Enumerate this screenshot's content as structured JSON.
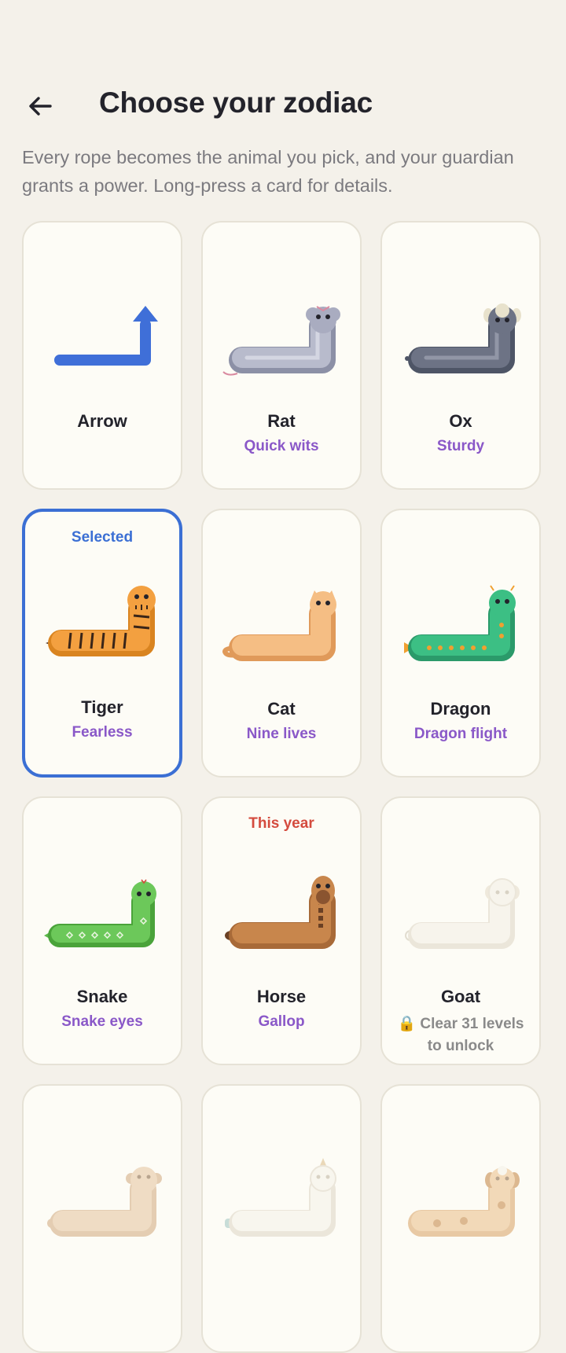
{
  "header": {
    "title": "Choose your zodiac",
    "subtitle": "Every rope becomes the animal you pick, and your guardian grants a power. Long-press a card for details.",
    "back_icon": "arrow-left-icon"
  },
  "colors": {
    "background": "#f4f1ea",
    "card": "#fdfcf6",
    "selected_border": "#3b6fd4",
    "power_text": "#8a58c8",
    "this_year_text": "#d44b3e"
  },
  "cards": [
    {
      "name": "Arrow",
      "power": "",
      "art": "arrow-icon"
    },
    {
      "name": "Rat",
      "power": "Quick wits",
      "art": "rat-rope-icon"
    },
    {
      "name": "Ox",
      "power": "Sturdy",
      "art": "ox-rope-icon"
    },
    {
      "name": "Tiger",
      "power": "Fearless",
      "badge": "Selected",
      "art": "tiger-rope-icon",
      "selected": true
    },
    {
      "name": "Cat",
      "power": "Nine lives",
      "art": "cat-rope-icon"
    },
    {
      "name": "Dragon",
      "power": "Dragon flight",
      "art": "dragon-rope-icon"
    },
    {
      "name": "Snake",
      "power": "Snake eyes",
      "art": "snake-rope-icon"
    },
    {
      "name": "Horse",
      "power": "Gallop",
      "badge": "This year",
      "art": "horse-rope-icon"
    },
    {
      "name": "Goat",
      "locked_line1": "🔒 Clear 31 levels",
      "locked_line2": "to unlock",
      "art": "goat-rope-icon",
      "locked": true
    },
    {
      "name": "",
      "art": "monkey-rope-icon",
      "locked": true
    },
    {
      "name": "",
      "art": "rooster-rope-icon",
      "locked": true
    },
    {
      "name": "",
      "art": "dog-rope-icon",
      "locked": true
    }
  ]
}
